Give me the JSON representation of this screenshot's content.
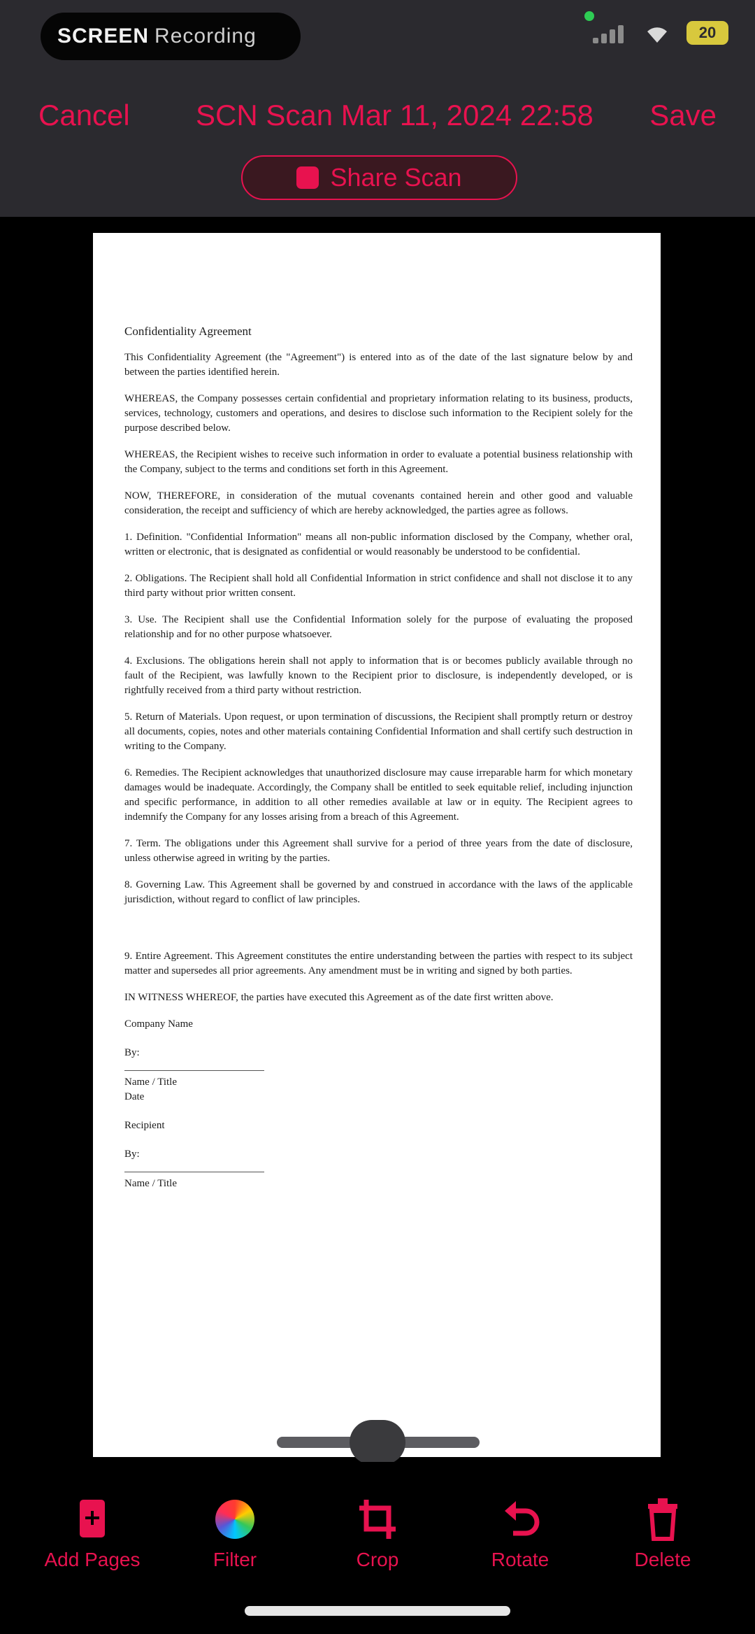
{
  "status_bar": {
    "recording_label": "SCREEN",
    "recording_sublabel": "Recording",
    "battery": "20",
    "icons": [
      "signal-icon",
      "wifi-icon",
      "battery-icon"
    ],
    "colors": {
      "background": "#2b2a2f",
      "battery": "#d8c83d",
      "dot": "#2ecc54"
    }
  },
  "nav": {
    "cancel_label": "Cancel",
    "title": "SCN Scan Mar 11, 2024 22:58",
    "save_label": "Save",
    "share_label": "Share Scan",
    "accent": "#e8124f"
  },
  "document": {
    "heading": "Confidentiality Agreement",
    "paragraphs": [
      "This Confidentiality Agreement (the \"Agreement\") is entered into as of the date of the last signature below by and between the parties identified herein.",
      "WHEREAS, the Company possesses certain confidential and proprietary information relating to its business, products, services, technology, customers and operations, and desires to disclose such information to the Recipient solely for the purpose described below.",
      "WHEREAS, the Recipient wishes to receive such information in order to evaluate a potential business relationship with the Company, subject to the terms and conditions set forth in this Agreement.",
      "NOW, THEREFORE, in consideration of the mutual covenants contained herein and other good and valuable consideration, the receipt and sufficiency of which are hereby acknowledged, the parties agree as follows.",
      "1. Definition. \"Confidential Information\" means all non-public information disclosed by the Company, whether oral, written or electronic, that is designated as confidential or would reasonably be understood to be confidential.",
      "2. Obligations. The Recipient shall hold all Confidential Information in strict confidence and shall not disclose it to any third party without prior written consent.",
      "3. Use. The Recipient shall use the Confidential Information solely for the purpose of evaluating the proposed relationship and for no other purpose whatsoever.",
      "4. Exclusions. The obligations herein shall not apply to information that is or becomes publicly available through no fault of the Recipient, was lawfully known to the Recipient prior to disclosure, is independently developed, or is rightfully received from a third party without restriction.",
      "5. Return of Materials. Upon request, or upon termination of discussions, the Recipient shall promptly return or destroy all documents, copies, notes and other materials containing Confidential Information and shall certify such destruction in writing to the Company.",
      "6. Remedies. The Recipient acknowledges that unauthorized disclosure may cause irreparable harm for which monetary damages would be inadequate. Accordingly, the Company shall be entitled to seek equitable relief, including injunction and specific performance, in addition to all other remedies available at law or in equity. The Recipient agrees to indemnify the Company for any losses arising from a breach of this Agreement.",
      "7. Term. The obligations under this Agreement shall survive for a period of three years from the date of disclosure, unless otherwise agreed in writing by the parties.",
      "8. Governing Law. This Agreement shall be governed by and construed in accordance with the laws of the applicable jurisdiction, without regard to conflict of law principles.",
      "9. Entire Agreement. This Agreement constitutes the entire understanding between the parties with respect to its subject matter and supersedes all prior agreements. Any amendment must be in writing and signed by both parties.",
      "IN WITNESS WHEREOF, the parties have executed this Agreement as of the date first written above."
    ],
    "party_one": "Company Name",
    "by_label": "By:",
    "name_title": "Name / Title",
    "date_label": "Date",
    "party_two": "Recipient",
    "recipient_name": "Name / Title"
  },
  "toolbar": {
    "add_label": "Add Pages",
    "filter_label": "Filter",
    "crop_label": "Crop",
    "rotate_label": "Rotate",
    "delete_label": "Delete",
    "accent": "#e8124f"
  }
}
